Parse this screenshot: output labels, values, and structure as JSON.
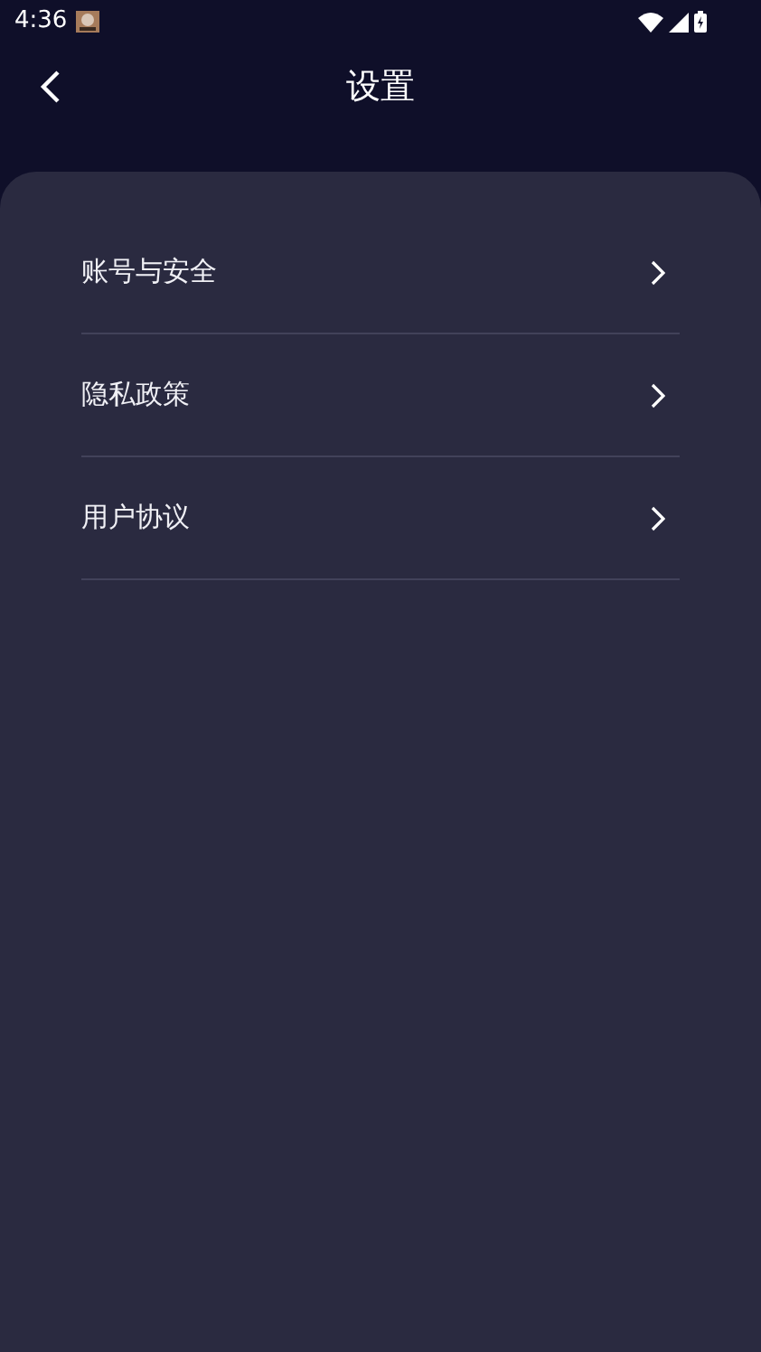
{
  "status_bar": {
    "time": "4:36"
  },
  "header": {
    "title": "设置"
  },
  "menu": [
    {
      "label": "账号与安全"
    },
    {
      "label": "隐私政策"
    },
    {
      "label": "用户协议"
    }
  ]
}
